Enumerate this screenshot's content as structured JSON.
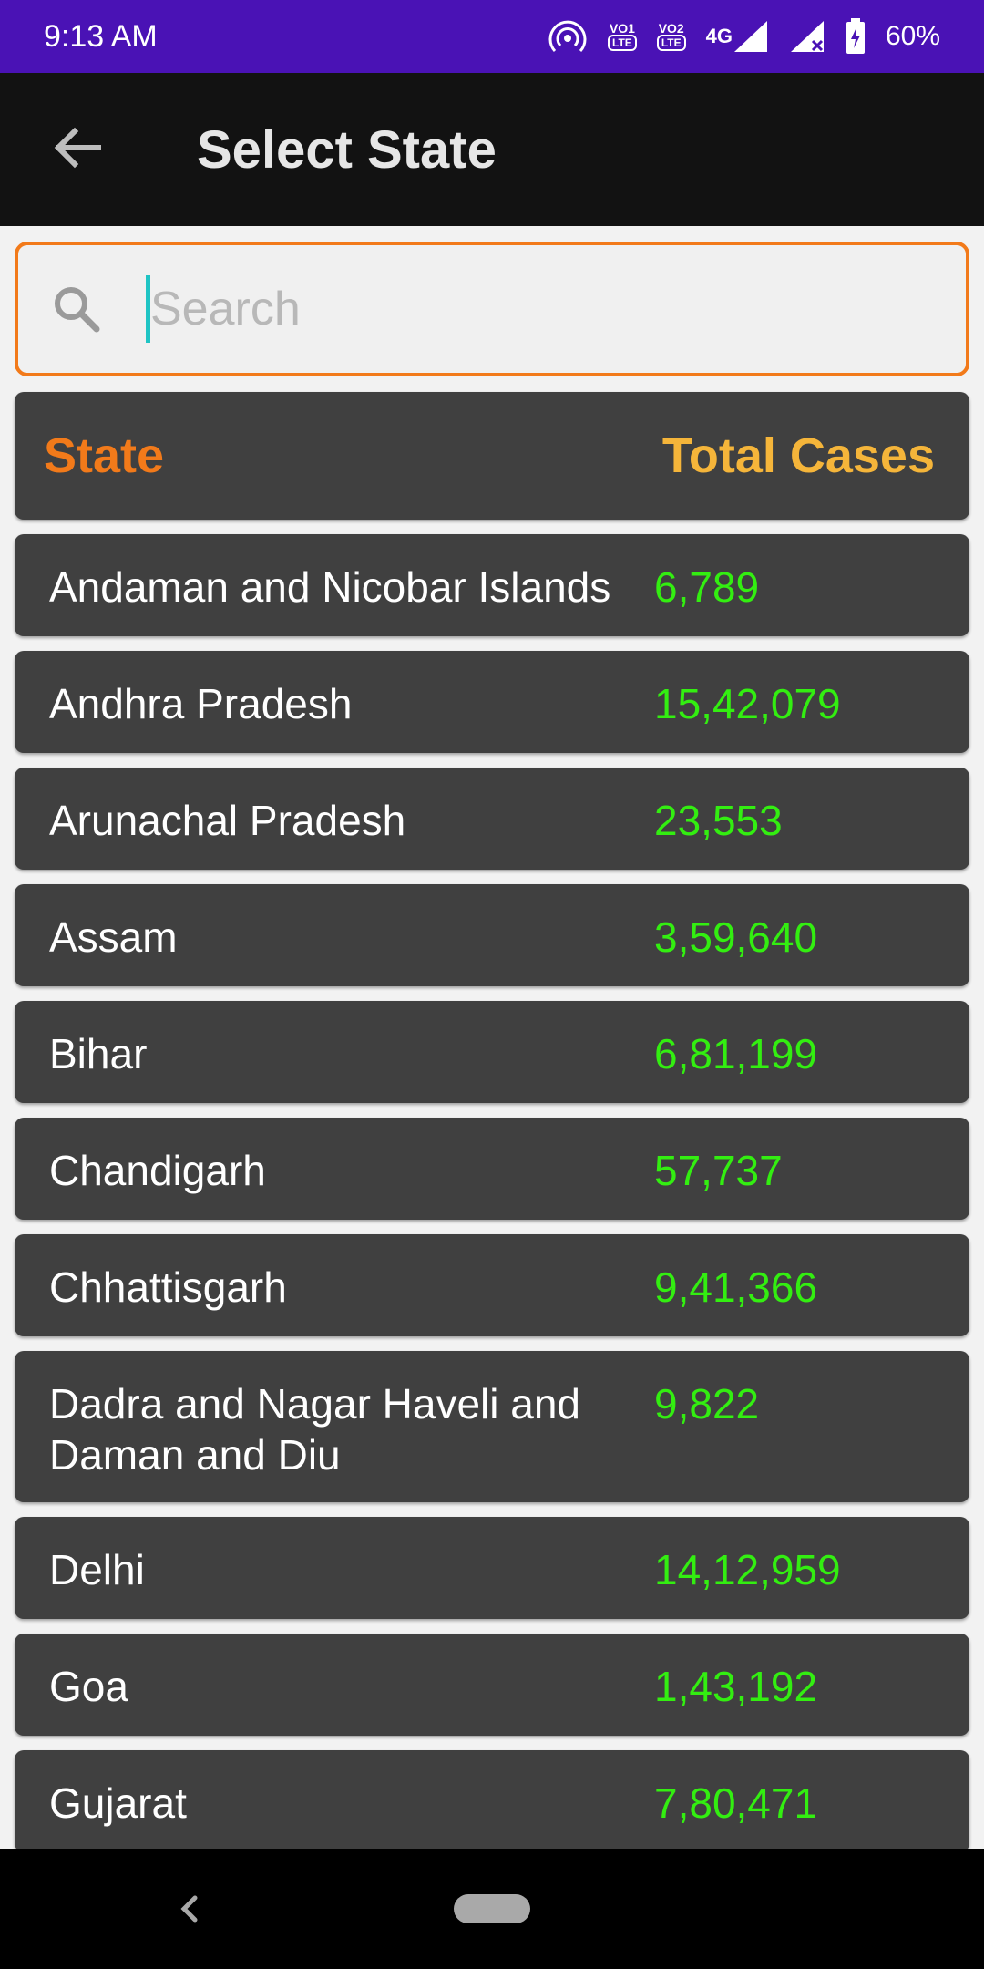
{
  "status_bar": {
    "time": "9:13 AM",
    "volte1": "VO1",
    "volte2": "VO2",
    "lte_label": "LTE",
    "network": "4G",
    "battery": "60%"
  },
  "app_bar": {
    "title": "Select State"
  },
  "search": {
    "placeholder": "Search",
    "value": ""
  },
  "table": {
    "header_state": "State",
    "header_total": "Total Cases",
    "rows": [
      {
        "state": "Andaman and Nicobar Islands",
        "total": "6,789"
      },
      {
        "state": "Andhra Pradesh",
        "total": "15,42,079"
      },
      {
        "state": "Arunachal Pradesh",
        "total": "23,553"
      },
      {
        "state": "Assam",
        "total": "3,59,640"
      },
      {
        "state": "Bihar",
        "total": "6,81,199"
      },
      {
        "state": "Chandigarh",
        "total": "57,737"
      },
      {
        "state": "Chhattisgarh",
        "total": "9,41,366"
      },
      {
        "state": "Dadra and Nagar Haveli and Daman and Diu",
        "total": "9,822"
      },
      {
        "state": "Delhi",
        "total": "14,12,959"
      },
      {
        "state": "Goa",
        "total": "1,43,192"
      },
      {
        "state": "Gujarat",
        "total": "7,80,471"
      }
    ]
  },
  "colors": {
    "status_bar": "#4a12b5",
    "app_bar": "#121212",
    "accent_orange": "#f27a1a",
    "header_total": "#f5b53a",
    "card": "#404040",
    "value_green": "#33ee11",
    "cursor": "#1fc4c4"
  },
  "icons": {
    "back": "arrow-left-icon",
    "search": "search-icon",
    "nav_back": "chevron-left-icon",
    "nav_home": "home-pill-icon"
  }
}
